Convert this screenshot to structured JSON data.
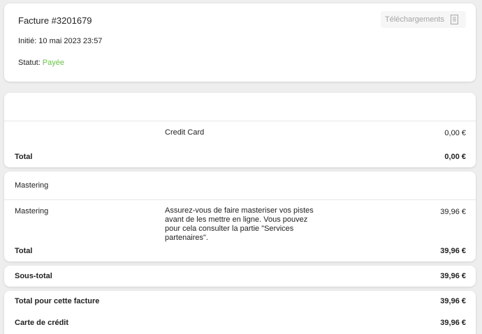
{
  "invoice": {
    "title": "Facture #3201679",
    "initiated_label": "Initié:",
    "initiated_value": "10 mai 2023 23:57",
    "status_label": "Statut:",
    "status_value": "Payée",
    "download_label": "Téléchargements",
    "download_icon": "document-icon"
  },
  "payment_section": {
    "method": "Credit Card",
    "method_amount": "0,00 €",
    "total_label": "Total",
    "total_amount": "0,00 €"
  },
  "mastering_section": {
    "header": "Mastering",
    "item_name": "Mastering",
    "item_description": "Assurez-vous de faire masteriser vos pistes avant de les mettre en ligne. Vous pouvez pour cela consulter la partie \"Services partenaires\".",
    "item_amount": "39,96 €",
    "total_label": "Total",
    "total_amount": "39,96 €"
  },
  "subtotal": {
    "label": "Sous-total",
    "amount": "39,96 €"
  },
  "totals": {
    "invoice_total_label": "Total pour cette facture",
    "invoice_total_amount": "39,96 €",
    "credit_card_label": "Carte de crédit",
    "credit_card_amount": "39,96 €"
  },
  "colors": {
    "status_paid": "#6cbf4b",
    "background": "#eeeeee",
    "card": "#ffffff"
  }
}
